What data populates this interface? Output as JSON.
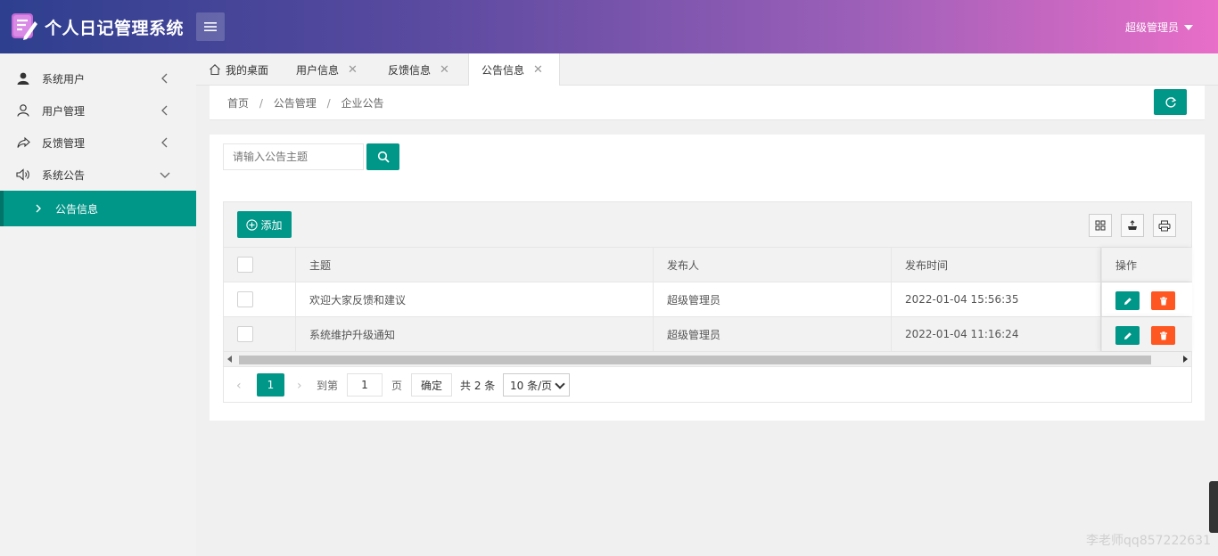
{
  "app": {
    "title": "个人日记管理系统"
  },
  "header": {
    "user_name": "超级管理员"
  },
  "sidebar": {
    "items": [
      {
        "label": "系统用户"
      },
      {
        "label": "用户管理"
      },
      {
        "label": "反馈管理"
      },
      {
        "label": "系统公告"
      }
    ],
    "sub_items": [
      {
        "label": "公告信息"
      }
    ]
  },
  "tabs": [
    {
      "label": "我的桌面"
    },
    {
      "label": "用户信息"
    },
    {
      "label": "反馈信息"
    },
    {
      "label": "公告信息"
    }
  ],
  "breadcrumb": {
    "items": [
      "首页",
      "公告管理",
      "企业公告"
    ],
    "separator": "/"
  },
  "search": {
    "placeholder": "请输入公告主题"
  },
  "toolbar": {
    "add_label": "添加"
  },
  "table": {
    "columns": [
      "主题",
      "发布人",
      "发布时间",
      "操作"
    ],
    "rows": [
      {
        "title": "欢迎大家反馈和建议",
        "publisher": "超级管理员",
        "time": "2022-01-04 15:56:35"
      },
      {
        "title": "系统维护升级通知",
        "publisher": "超级管理员",
        "time": "2022-01-04 11:16:24"
      }
    ]
  },
  "pager": {
    "current": "1",
    "goto_label": "到第",
    "page_input": "1",
    "page_unit": "页",
    "ok_label": "确定",
    "total": "共 2 条",
    "page_size": "10 条/页"
  },
  "watermark": "李老师qq857222631",
  "colors": {
    "primary": "#009688",
    "danger": "#ff5722"
  }
}
